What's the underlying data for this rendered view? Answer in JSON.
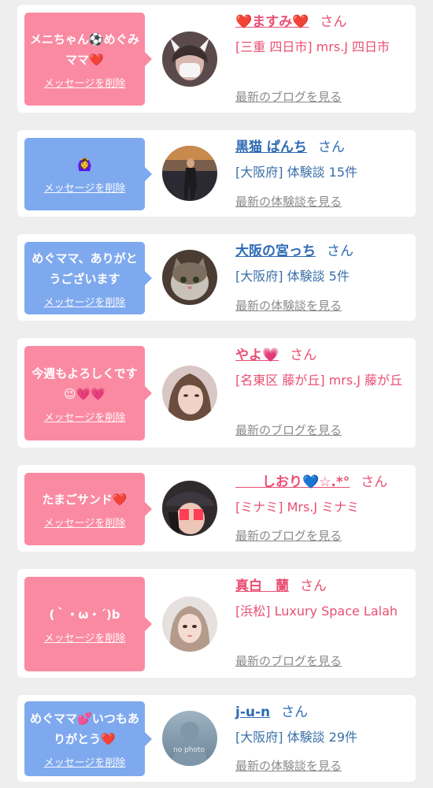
{
  "delete_label": "メッセージを削除",
  "san": "さん",
  "cards": [
    {
      "message": "メニちゃん⚽めぐみママ❤️",
      "name": "❤️ますみ❤️",
      "detail": "[三重 四日市] mrs.J 四日市",
      "more": "最新のブログを見る"
    },
    {
      "message": "🙆‍♀️",
      "name": "黒猫 ぱんち",
      "detail": "[大阪府] 体験談 15件",
      "more": "最新の体験談を見る"
    },
    {
      "message": "めぐママ、ありがとうございます",
      "name": "大阪の宮っち",
      "detail": "[大阪府] 体験談 5件",
      "more": "最新の体験談を見る"
    },
    {
      "message": "今週もよろしくです😉💗💗",
      "name": "やよ💗",
      "detail": "[名東区 藤が丘] mrs.J 藤が丘",
      "more": "最新のブログを見る"
    },
    {
      "message": "たまごサンド❤️",
      "name": "　　しおり💙☆.*°",
      "detail": "[ミナミ] Mrs.J ミナミ",
      "more": "最新のブログを見る"
    },
    {
      "message": "(｀・ω・´)b",
      "name": "真白　蘭",
      "detail": "[浜松] Luxury Space Lalah",
      "more": "最新のブログを見る"
    },
    {
      "message": "めぐママ💕いつもありがとう❤️",
      "name": "j-u-n",
      "detail": "[大阪府] 体験談 29件",
      "more": "最新の体験談を見る",
      "avatar_text": "no photo"
    }
  ]
}
